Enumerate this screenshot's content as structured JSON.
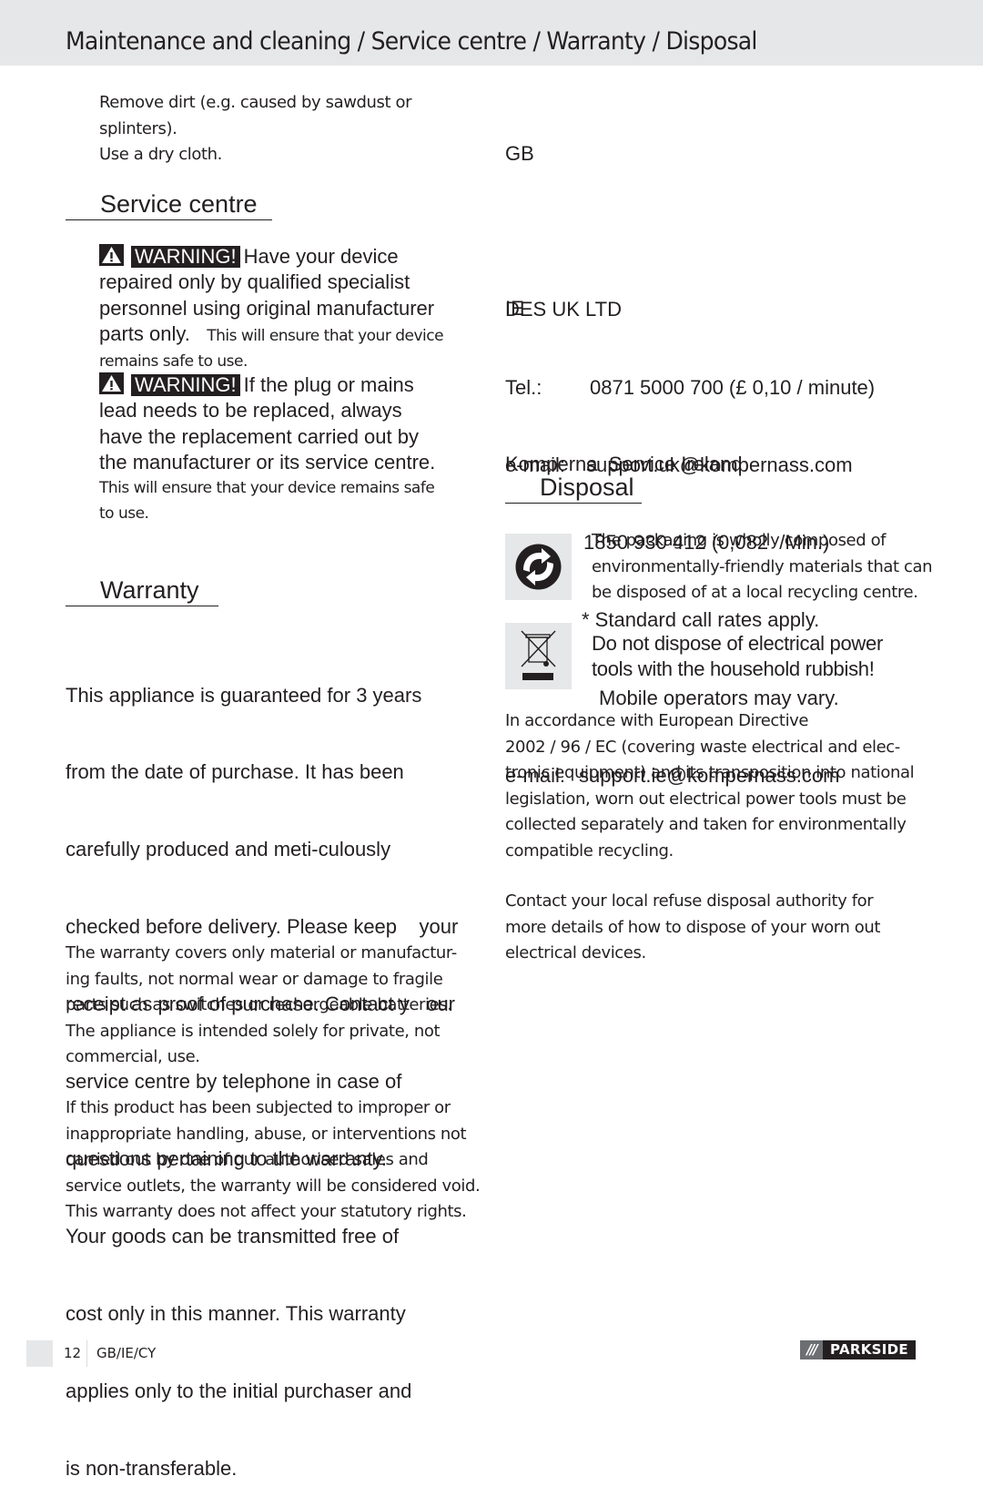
{
  "header": {
    "title": "Maintenance and cleaning / Service centre / Warranty / Disposal"
  },
  "maintenance": {
    "lines": [
      "Remove dirt (e.g. caused by sawdust or splinters).",
      "Use a dry cloth."
    ]
  },
  "service_centre": {
    "heading": "Service centre",
    "warning_label": "WARNING!",
    "warning1": {
      "lines": [
        "Have your device",
        "repaired only by qualified specialist",
        "personnel using original manufacturer",
        "parts only."
      ],
      "note_inline": "This will ensure that your device",
      "note_tail": "remains safe to use."
    },
    "warning2": {
      "lines": [
        "If the plug or mains",
        "lead needs to be replaced, always",
        "have the replacement carried out by",
        "the manufacturer or its service centre."
      ],
      "note_lines": [
        "This will ensure that your device remains safe",
        "to use."
      ]
    }
  },
  "warranty": {
    "heading": "Warranty",
    "main_lines": [
      "This appliance is guaranteed for 3 years",
      "from the date of purchase. It has been",
      "carefully produced and meti-culously",
      "checked before delivery. Please keep    your",
      "receipt as proof of purchase. Contact y   our",
      "service centre by telephone in case of",
      "questions pertaining to the warranty.",
      "Your goods can be transmitted free of",
      "cost only in this manner. This warranty",
      "applies only to the initial purchaser and",
      "is non-transferable."
    ],
    "coverage_lines": [
      "The warranty covers only material or manufactur-",
      "ing faults, not normal wear or damage to fragile",
      "parts such as switches or rechargeable batteries.",
      "The appliance is intended solely for private, not",
      "commercial, use."
    ],
    "void_lines": [
      "If this product has been subjected to improper or",
      "inappropriate handling, abuse, or interventions not",
      "carried out by one of our authorised sales and",
      "service outlets, the warranty will be considered void.",
      "This warranty does not affect your statutory rights."
    ]
  },
  "contacts": {
    "gb": {
      "country": "GB",
      "company": "DES UK LTD",
      "tel_label": "Tel.:",
      "tel_value": "0871 5000 700 (£ 0,10 / minute)",
      "email_label": "e-mail:",
      "email_value": "support.uk@kompernass.com"
    },
    "ie": {
      "country": "IE",
      "company": "Komperna  Service Ireland",
      "tel_label": "Tel.:",
      "tel_value": "1850 930 412 (0,082  /Min.)",
      "note1": "* Standard call rates apply.",
      "note2": "Mobile operators may vary.",
      "email_label": "e-mail:",
      "email_value": "support.ie@kompernass.com"
    }
  },
  "disposal": {
    "heading": "Disposal",
    "packaging_lines": [
      "The packaging is wholly composed of",
      "environmentally-friendly materials that can",
      "be disposed of at a local recycling centre."
    ],
    "weee_lines": [
      "Do not dispose of electrical power",
      "tools with the household rubbish!"
    ],
    "directive_lines": [
      "In accordance with European Directive",
      "2002 / 96 / EC (covering waste electrical and elec-",
      "tronic equipment) and its transposition into national",
      "legislation, worn out electrical power tools must be",
      "collected separately and taken for environmentally",
      "compatible recycling."
    ],
    "contact_lines": [
      "Contact your local refuse disposal authority for",
      "more details of how to dispose of your worn out",
      "electrical devices."
    ]
  },
  "footer": {
    "page_number": "12",
    "languages": "GB/IE/CY",
    "brand": "PARKSIDE",
    "brand_stripes": "///"
  }
}
